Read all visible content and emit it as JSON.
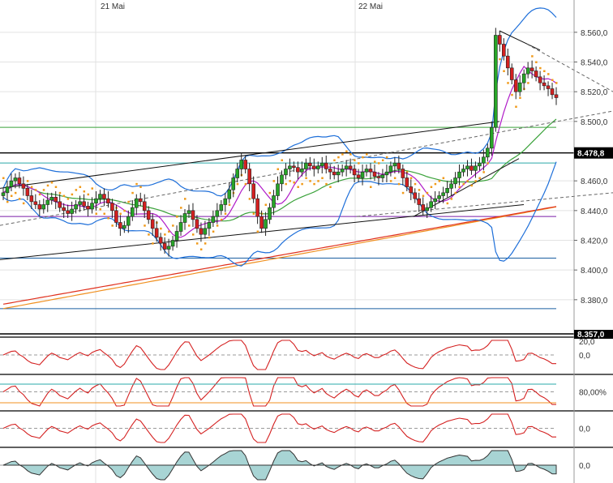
{
  "chart_data": {
    "type": "candlestick",
    "x_labels": [
      "21 Mai",
      "22 Mai"
    ],
    "price_axis": {
      "ticks": [
        "8.560,0",
        "8.540,0",
        "8.520,0",
        "8.500,0",
        "8.460,0",
        "8.440,0",
        "8.420,0",
        "8.400,0",
        "8.380,0"
      ],
      "ylim": [
        8357,
        8573
      ]
    },
    "current_price_label": "8.478,8",
    "bottom_price_label": "8.357,0",
    "candles_close": [
      8452,
      8456,
      8460,
      8462,
      8458,
      8455,
      8450,
      8446,
      8444,
      8441,
      8444,
      8447,
      8449,
      8446,
      8442,
      8440,
      8438,
      8441,
      8444,
      8446,
      8443,
      8441,
      8445,
      8448,
      8451,
      8448,
      8445,
      8440,
      8432,
      8428,
      8430,
      8436,
      8442,
      8448,
      8446,
      8440,
      8434,
      8428,
      8422,
      8418,
      8414,
      8416,
      8420,
      8426,
      8432,
      8438,
      8440,
      8434,
      8428,
      8424,
      8428,
      8432,
      8436,
      8440,
      8444,
      8448,
      8454,
      8462,
      8468,
      8474,
      8468,
      8458,
      8448,
      8436,
      8428,
      8434,
      8442,
      8450,
      8458,
      8464,
      8468,
      8470,
      8469,
      8466,
      8468,
      8472,
      8470,
      8468,
      8470,
      8472,
      8468,
      8466,
      8464,
      8466,
      8468,
      8470,
      8468,
      8464,
      8462,
      8466,
      8468,
      8466,
      8463,
      8462,
      8464,
      8466,
      8470,
      8472,
      8468,
      8462,
      8456,
      8452,
      8448,
      8444,
      8440,
      8442,
      8446,
      8448,
      8450,
      8452,
      8455,
      8458,
      8462,
      8466,
      8468,
      8470,
      8467,
      8470,
      8472,
      8476,
      8482,
      8496,
      8558,
      8552,
      8544,
      8536,
      8528,
      8520,
      8526,
      8532,
      8536,
      8534,
      8530,
      8526,
      8524,
      8522,
      8518,
      8516
    ],
    "series": [
      {
        "name": "",
        "type": "bollinger-upper",
        "color": "#1e6fd9"
      },
      {
        "name": "",
        "type": "bollinger-lower",
        "color": "#1e6fd9"
      },
      {
        "name": "",
        "type": "ma-fast",
        "color": "#b01cc8"
      },
      {
        "name": "",
        "type": "ma-mid",
        "color": "#3aa23a"
      },
      {
        "name": "",
        "type": "ma-slow",
        "color": "#e0311e"
      },
      {
        "name": "",
        "type": "ma-slow-2",
        "color": "#f09020"
      },
      {
        "name": "",
        "type": "parabolic-sar",
        "color": "#f09a1a"
      }
    ],
    "horizontal_levels": [
      8496,
      8472,
      8436,
      8408,
      8374
    ],
    "grid": true,
    "panels": [
      {
        "name": "",
        "ticks": [
          "20,0",
          "0,0"
        ]
      },
      {
        "name": "",
        "ticks": [
          "80,00%"
        ]
      },
      {
        "name": "",
        "ticks": [
          "0,0"
        ]
      },
      {
        "name": "",
        "ticks": [
          "0,0"
        ]
      }
    ]
  },
  "colors": {
    "candle_up": "#27a527",
    "candle_down": "#d42020",
    "grid": "#e2e2e2",
    "badge": "#000000"
  }
}
